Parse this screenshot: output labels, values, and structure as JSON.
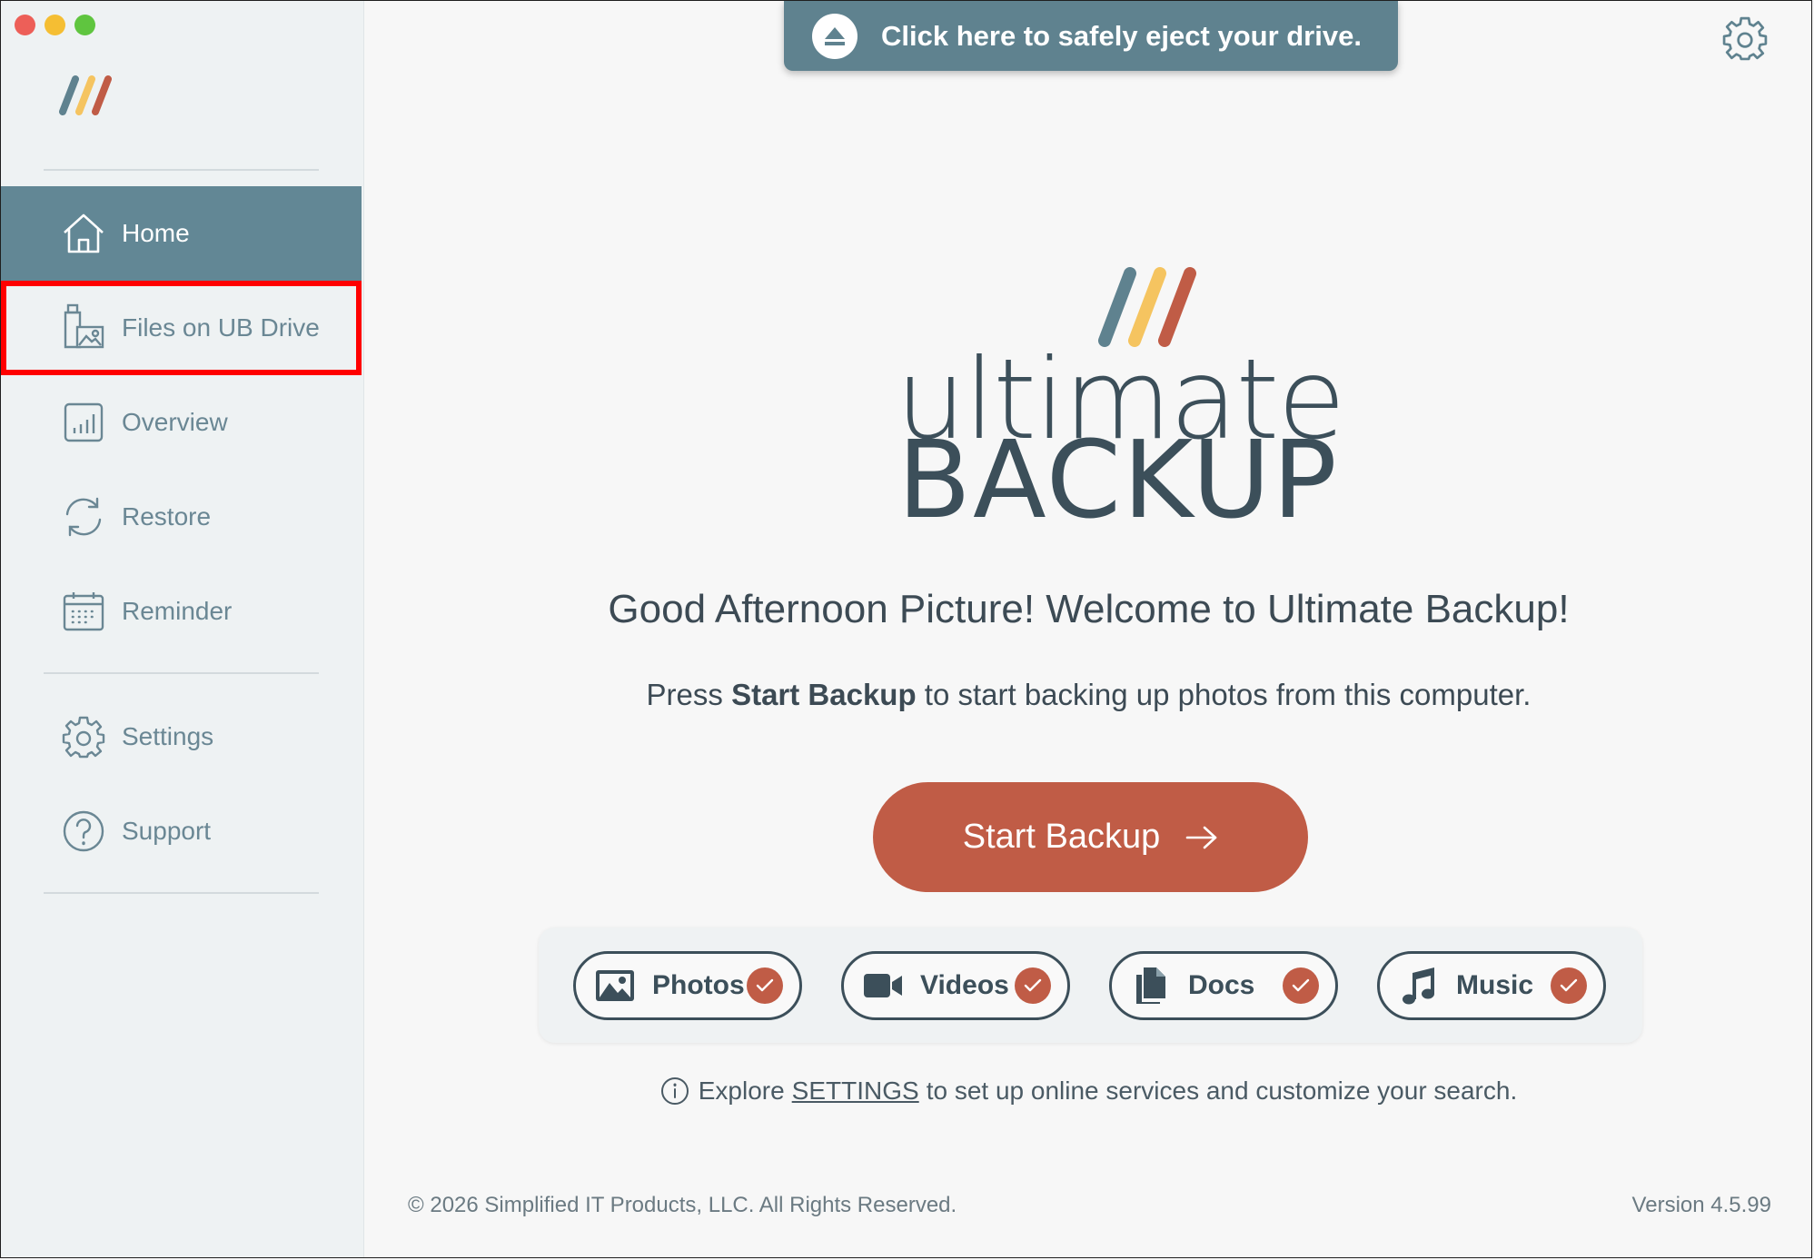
{
  "window": {
    "traffic_lights": [
      "close",
      "minimize",
      "zoom"
    ]
  },
  "sidebar": {
    "items": [
      {
        "label": "Home",
        "icon": "home-icon",
        "active": true
      },
      {
        "label": "Files on UB Drive",
        "icon": "usb-drive-photo-icon",
        "highlighted": true
      },
      {
        "label": "Overview",
        "icon": "bar-chart-icon"
      },
      {
        "label": "Restore",
        "icon": "refresh-icon"
      },
      {
        "label": "Reminder",
        "icon": "calendar-icon"
      },
      {
        "label": "Settings",
        "icon": "gear-icon"
      },
      {
        "label": "Support",
        "icon": "question-icon"
      }
    ]
  },
  "eject": {
    "label": "Click here to safely eject your drive.",
    "icon": "eject-icon"
  },
  "brand": {
    "line1": "ultimate",
    "line2": "BACKUP",
    "stripe_colors": [
      "#5f828f",
      "#f5c460",
      "#c05c46"
    ]
  },
  "main": {
    "greeting": "Good Afternoon Picture! Welcome to Ultimate Backup!",
    "sub_prefix": "Press ",
    "sub_bold": "Start Backup",
    "sub_suffix": " to start backing up photos from this computer.",
    "start_button": "Start Backup"
  },
  "types": [
    {
      "label": "Photos",
      "icon": "photo-icon",
      "checked": true
    },
    {
      "label": "Videos",
      "icon": "video-camera-icon",
      "checked": true
    },
    {
      "label": "Docs",
      "icon": "documents-icon",
      "checked": true
    },
    {
      "label": "Music",
      "icon": "music-note-icon",
      "checked": true
    }
  ],
  "explore": {
    "prefix": "Explore",
    "link": "SETTINGS",
    "suffix": "to set up online services and customize your search."
  },
  "footer": {
    "copyright": "© 2026 Simplified IT Products, LLC. All Rights Reserved.",
    "version": "Version 4.5.99"
  },
  "colors": {
    "accent": "#c05c46",
    "sidebar_active": "#628795",
    "text_dark": "#3c4f5a"
  }
}
